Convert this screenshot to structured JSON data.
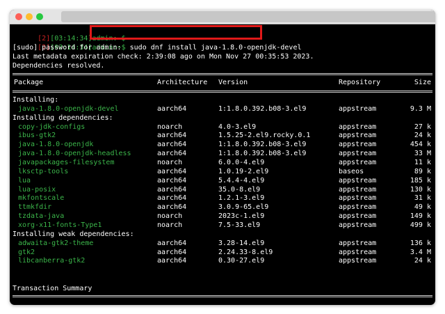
{
  "prompt": {
    "bracket_open": "[",
    "num": "2",
    "bracket_close": "]",
    "time": "[03:14:34]",
    "user": "admin:~$"
  },
  "command": "sudo dnf install java-1.8.0-openjdk-devel",
  "sudo_prompt": "[sudo] password for admin:",
  "metadata_line": "Last metadata expiration check: 2:39:08 ago on Mon Nov 27 00:35:53 2023.",
  "deps_resolved": "Dependencies resolved.",
  "table": {
    "headers": {
      "package": "Package",
      "arch": "Architecture",
      "version": "Version",
      "repo": "Repository",
      "size": "Size"
    },
    "sections": [
      {
        "title": "Installing:",
        "rows": [
          {
            "name": "java-1.8.0-openjdk-devel",
            "arch": "aarch64",
            "version": "1:1.8.0.392.b08-3.el9",
            "repo": "appstream",
            "size": "9.3 M"
          }
        ]
      },
      {
        "title": "Installing dependencies:",
        "rows": [
          {
            "name": "copy-jdk-configs",
            "arch": "noarch",
            "version": "4.0-3.el9",
            "repo": "appstream",
            "size": "27 k"
          },
          {
            "name": "ibus-gtk2",
            "arch": "aarch64",
            "version": "1.5.25-2.el9.rocky.0.1",
            "repo": "appstream",
            "size": "24 k"
          },
          {
            "name": "java-1.8.0-openjdk",
            "arch": "aarch64",
            "version": "1:1.8.0.392.b08-3.el9",
            "repo": "appstream",
            "size": "454 k"
          },
          {
            "name": "java-1.8.0-openjdk-headless",
            "arch": "aarch64",
            "version": "1:1.8.0.392.b08-3.el9",
            "repo": "appstream",
            "size": "33 M"
          },
          {
            "name": "javapackages-filesystem",
            "arch": "noarch",
            "version": "6.0.0-4.el9",
            "repo": "appstream",
            "size": "11 k"
          },
          {
            "name": "lksctp-tools",
            "arch": "aarch64",
            "version": "1.0.19-2.el9",
            "repo": "baseos",
            "size": "89 k"
          },
          {
            "name": "lua",
            "arch": "aarch64",
            "version": "5.4.4-4.el9",
            "repo": "appstream",
            "size": "185 k"
          },
          {
            "name": "lua-posix",
            "arch": "aarch64",
            "version": "35.0-8.el9",
            "repo": "appstream",
            "size": "130 k"
          },
          {
            "name": "mkfontscale",
            "arch": "aarch64",
            "version": "1.2.1-3.el9",
            "repo": "appstream",
            "size": "31 k"
          },
          {
            "name": "ttmkfdir",
            "arch": "aarch64",
            "version": "3.0.9-65.el9",
            "repo": "appstream",
            "size": "49 k"
          },
          {
            "name": "tzdata-java",
            "arch": "noarch",
            "version": "2023c-1.el9",
            "repo": "appstream",
            "size": "149 k"
          },
          {
            "name": "xorg-x11-fonts-Type1",
            "arch": "noarch",
            "version": "7.5-33.el9",
            "repo": "appstream",
            "size": "499 k"
          }
        ]
      },
      {
        "title": "Installing weak dependencies:",
        "rows": [
          {
            "name": "adwaita-gtk2-theme",
            "arch": "aarch64",
            "version": "3.28-14.el9",
            "repo": "appstream",
            "size": "136 k"
          },
          {
            "name": "gtk2",
            "arch": "aarch64",
            "version": "2.24.33-8.el9",
            "repo": "appstream",
            "size": "3.4 M"
          },
          {
            "name": "libcanberra-gtk2",
            "arch": "aarch64",
            "version": "0.30-27.el9",
            "repo": "appstream",
            "size": "24 k"
          }
        ]
      }
    ]
  },
  "transaction_summary": "Transaction Summary",
  "colors": {
    "prompt_red": "#cc2222",
    "prompt_green": "#3bb54a",
    "package_green": "#3bb54a",
    "highlight_box": "#e01919",
    "background": "#000000"
  }
}
